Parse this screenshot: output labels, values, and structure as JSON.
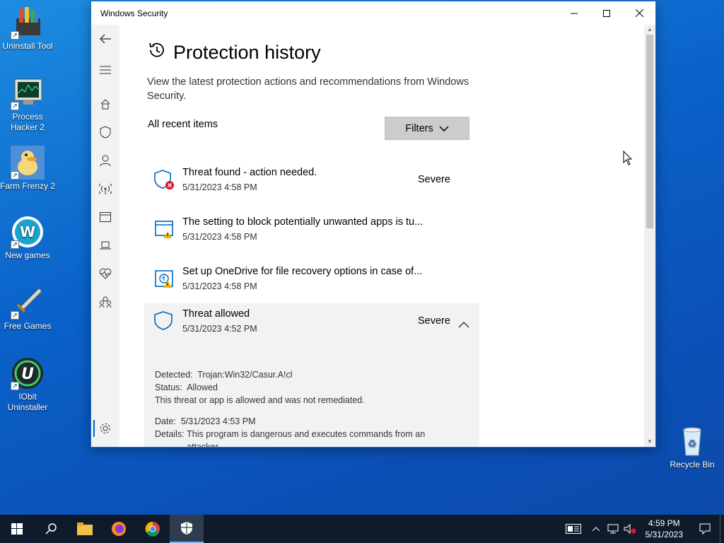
{
  "desktop": {
    "icons": [
      {
        "label": "Uninstall Tool"
      },
      {
        "label": "Process Hacker 2"
      },
      {
        "label": "Farm Frenzy 2"
      },
      {
        "label": "New games"
      },
      {
        "label": "Free Games"
      },
      {
        "label": "IObit Uninstaller"
      },
      {
        "label": "Recycle Bin"
      }
    ]
  },
  "window": {
    "title": "Windows Security",
    "controls": {
      "minimize": "minimize-icon",
      "maximize": "maximize-icon",
      "close": "close-icon"
    }
  },
  "nav": {
    "items": [
      "back-arrow-icon",
      "menu-icon",
      "home-icon",
      "shield-icon",
      "account-icon",
      "wifi-icon",
      "app-browser-icon",
      "laptop-icon",
      "heart-icon",
      "family-icon",
      "gear-icon"
    ]
  },
  "page": {
    "title": "Protection history",
    "description": "View the latest protection actions and recommendations from Windows Security.",
    "section_label": "All recent items",
    "filters_label": "Filters"
  },
  "items": [
    {
      "title": "Threat found - action needed.",
      "date": "5/31/2023 4:58 PM",
      "severity": "Severe",
      "icon": "shield-error-icon"
    },
    {
      "title": "The setting to block potentially unwanted apps is tu...",
      "date": "5/31/2023 4:58 PM",
      "severity": "",
      "icon": "app-warning-icon"
    },
    {
      "title": "Set up OneDrive for file recovery options in case of...",
      "date": "5/31/2023 4:58 PM",
      "severity": "",
      "icon": "onedrive-warning-icon"
    },
    {
      "title": "Threat allowed",
      "date": "5/31/2023 4:52 PM",
      "severity": "Severe",
      "icon": "shield-icon"
    }
  ],
  "details": {
    "detected_label": "Detected:",
    "detected_value": "Trojan:Win32/Casur.A!cl",
    "status_label": "Status:",
    "status_value": "Allowed",
    "note": "This threat or app is allowed and was not remediated.",
    "date_label": "Date:",
    "date_value": "5/31/2023 4:53 PM",
    "details_label": "Details:",
    "details_value_1": "This program is dangerous and executes commands from an",
    "details_value_2": "attacker."
  },
  "taskbar": {
    "time": "4:59 PM",
    "date": "5/31/2023"
  },
  "colors": {
    "accent": "#0067c0",
    "error": "#e81123",
    "warning": "#f7b500"
  }
}
